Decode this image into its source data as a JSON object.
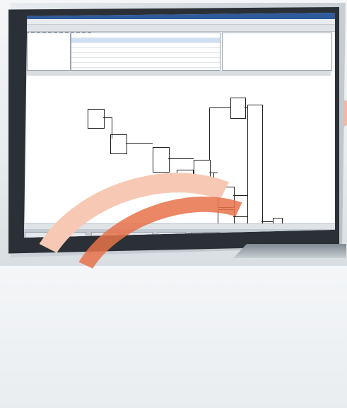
{
  "window": {
    "title": "",
    "menu": [],
    "tabs": []
  },
  "colors": {
    "titlebar": "#2f5a9c",
    "accent_orange": "#e8734b",
    "accent_peach": "#f7c9b4"
  },
  "icons": [
    "toolbar-icon"
  ]
}
